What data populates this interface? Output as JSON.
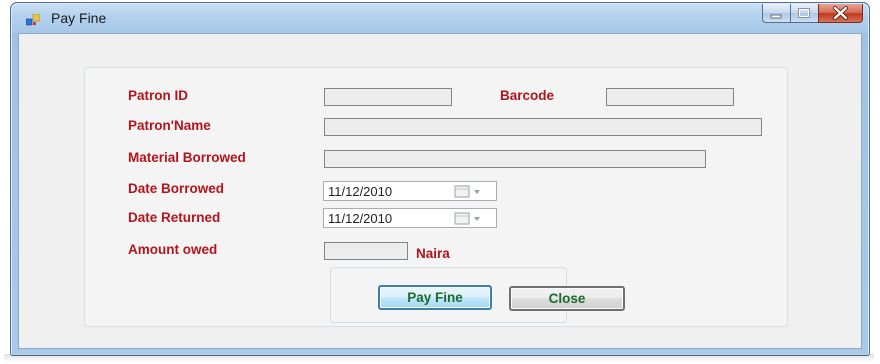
{
  "window": {
    "title": "Pay Fine"
  },
  "form": {
    "patron_id_label": "Patron ID",
    "patron_id_value": "",
    "barcode_label": "Barcode",
    "barcode_value": "",
    "patron_name_label": "Patron'Name",
    "patron_name_value": "",
    "material_borrowed_label": "Material Borrowed",
    "material_borrowed_value": "",
    "date_borrowed_label": "Date Borrowed",
    "date_borrowed_value": "11/12/2010",
    "date_returned_label": "Date Returned",
    "date_returned_value": "11/12/2010",
    "amount_owed_label": "Amount owed",
    "amount_owed_value": "",
    "currency_label": "Naira"
  },
  "buttons": {
    "pay_fine_label": "Pay Fine",
    "close_label": "Close"
  },
  "icons": {
    "app": "form-icon",
    "minimize": "minimize-icon",
    "maximize": "maximize-icon",
    "close": "close-icon",
    "calendar": "calendar-dropdown-icon"
  },
  "colors": {
    "label_text": "#b3141b",
    "button_text": "#1a6b2b",
    "title_bar": "#b3d1ee"
  }
}
